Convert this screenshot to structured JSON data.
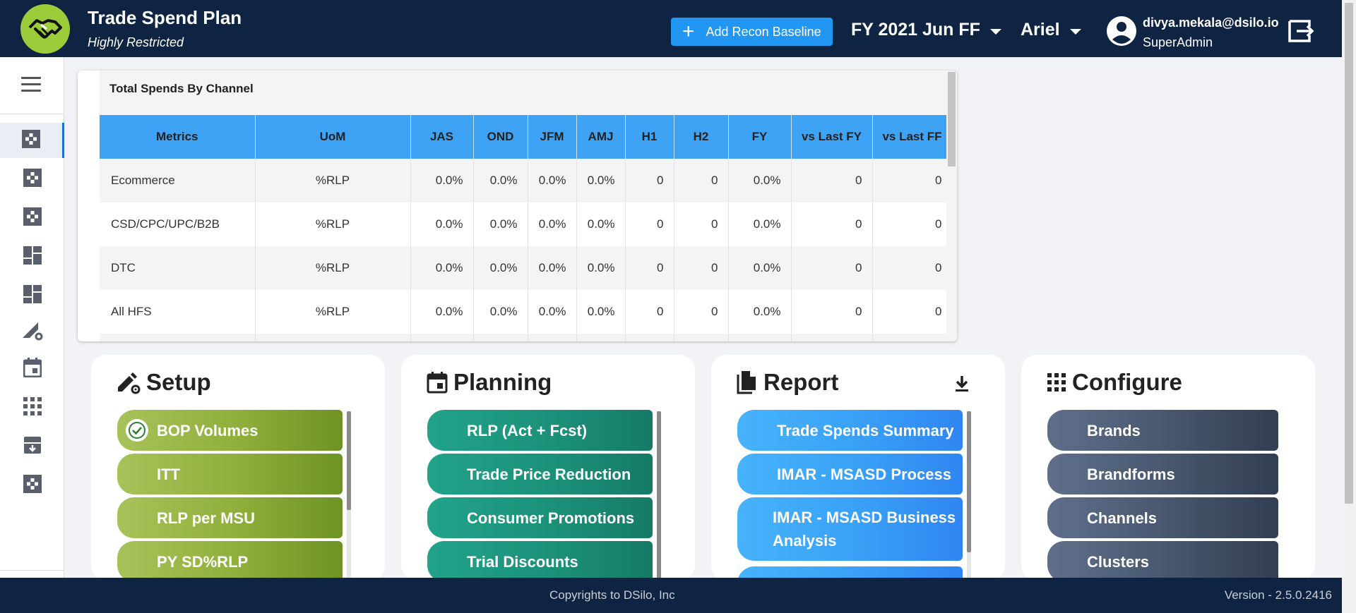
{
  "header": {
    "title": "Trade Spend Plan",
    "subtitle": "Highly Restricted",
    "add_button": "Add Recon Baseline",
    "period": "FY 2021 Jun FF",
    "brand": "Ariel",
    "user_email": "divya.mekala@dsilo.io",
    "user_role": "SuperAdmin"
  },
  "sidebar": {
    "items": [
      "setup-icon",
      "setup-icon",
      "setup-icon",
      "dashboard-icon",
      "dashboard-icon",
      "settings-chart-icon",
      "calendar-icon",
      "apps-icon",
      "archive-icon",
      "setup-icon"
    ],
    "active_index": 0
  },
  "table": {
    "title": "Total Spends By Channel",
    "columns": [
      "Metrics",
      "UoM",
      "JAS",
      "OND",
      "JFM",
      "AMJ",
      "H1",
      "H2",
      "FY",
      "vs Last FY",
      "vs Last FF"
    ],
    "rows": [
      [
        "Ecommerce",
        "%RLP",
        "0.0%",
        "0.0%",
        "0.0%",
        "0.0%",
        "0",
        "0",
        "0.0%",
        "0",
        "0"
      ],
      [
        "CSD/CPC/UPC/B2B",
        "%RLP",
        "0.0%",
        "0.0%",
        "0.0%",
        "0.0%",
        "0",
        "0",
        "0.0%",
        "0",
        "0"
      ],
      [
        "DTC",
        "%RLP",
        "0.0%",
        "0.0%",
        "0.0%",
        "0.0%",
        "0",
        "0",
        "0.0%",
        "0",
        "0"
      ],
      [
        "All HFS",
        "%RLP",
        "0.0%",
        "0.0%",
        "0.0%",
        "0.0%",
        "0",
        "0",
        "0.0%",
        "0",
        "0"
      ],
      [
        "",
        "",
        "",
        "",
        "",
        "",
        "",
        "",
        "",
        "",
        ""
      ]
    ]
  },
  "panels": {
    "setup": {
      "title": "Setup",
      "items": [
        "BOP Volumes",
        "ITT",
        "RLP per MSU",
        "PY SD%RLP"
      ]
    },
    "planning": {
      "title": "Planning",
      "items": [
        "RLP (Act + Fcst)",
        "Trade Price Reduction",
        "Consumer Promotions",
        "Trial Discounts"
      ]
    },
    "report": {
      "title": "Report",
      "items": [
        "Trade Spends Summary",
        "IMAR - MSASD Process",
        "IMAR - MSASD Business Analysis",
        ""
      ]
    },
    "configure": {
      "title": "Configure",
      "items": [
        "Brands",
        "Brandforms",
        "Channels",
        "Clusters"
      ]
    }
  },
  "footer": {
    "copyright": "Copyrights to DSilo, Inc",
    "version": "Version - 2.5.0.2416"
  },
  "colors": {
    "header_bg": "#0e2442",
    "accent": "#2196f3",
    "table_header": "#3fa3f5",
    "setup_green": "#8fae3a",
    "planning_teal": "#1b8f78",
    "report_blue": "#3aa2f7",
    "configure_slate": "#495870"
  }
}
